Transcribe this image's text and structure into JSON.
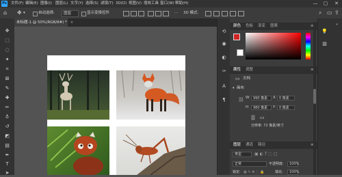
{
  "app": {
    "logo": "Ps"
  },
  "menu": [
    "文件(F)",
    "编辑(E)",
    "图像(I)",
    "图层(L)",
    "文字(Y)",
    "选择(S)",
    "滤镜(T)",
    "3D(D)",
    "视图(V)",
    "增效工具",
    "窗口(W)",
    "帮助(H)"
  ],
  "window_controls": {
    "minimize": "—",
    "maximize": "▢",
    "close": "✕"
  },
  "options": {
    "auto_select_label": "自动选择:",
    "auto_select_value": "图层",
    "transform_label": "显示变换控件",
    "more": "···"
  },
  "tab": {
    "title": "未标题-1 @ 50%(RGB/8#) *",
    "close": "×"
  },
  "panels": {
    "color_tabs": [
      "颜色",
      "色板",
      "渐变",
      "图案"
    ],
    "props_tabs": [
      "属性",
      "调整"
    ],
    "doc_label": "文档",
    "canvas_label": "画布",
    "width_label": "W",
    "width_value": "990 像素",
    "height_label": "H",
    "height_value": "980 像素",
    "x_label": "X",
    "x_value": "0 像素",
    "y_label": "Y",
    "y_value": "0 像素",
    "resolution": "分辨率: 72 像素/英寸",
    "layers_tabs": [
      "图层",
      "通道",
      "路径"
    ],
    "kind_label": "类型",
    "mode_label": "正常",
    "opacity_label": "不透明度:",
    "opacity_value": "100%",
    "lock_label": "锁定:",
    "fill_label": "填充:",
    "fill_value": "100%"
  },
  "colors": {
    "foreground": "#d02525",
    "background": "#ffffff",
    "picker_hue": "#ff0000",
    "accent": "#31a8ff"
  }
}
